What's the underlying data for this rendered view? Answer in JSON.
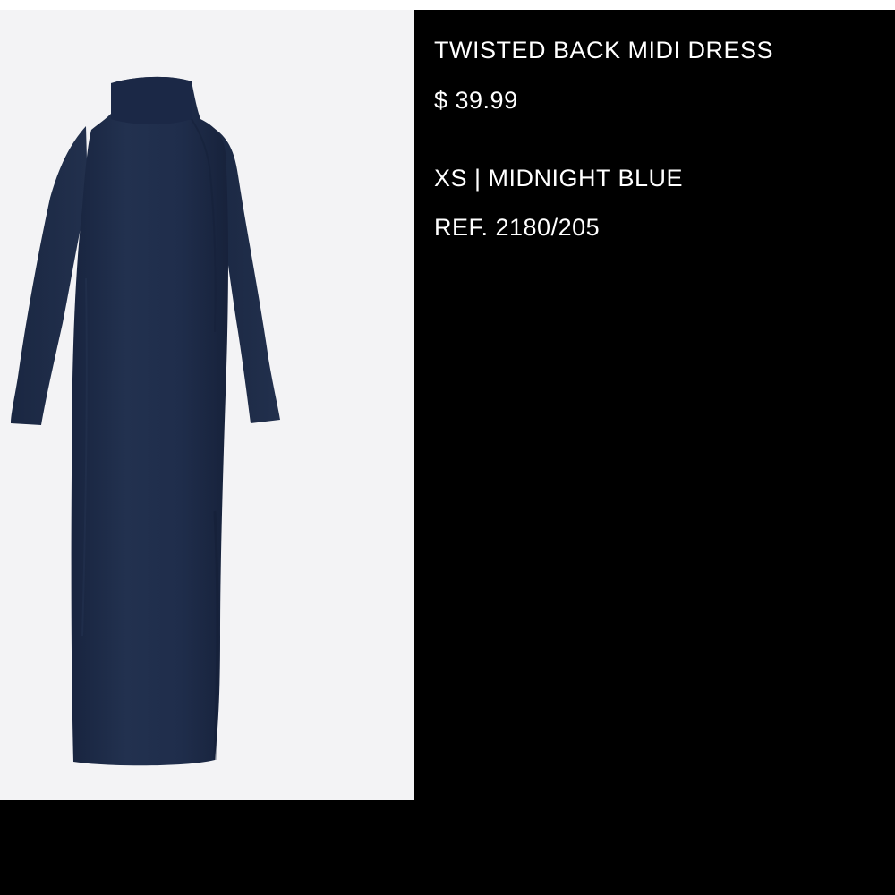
{
  "product": {
    "title": "TWISTED BACK MIDI DRESS",
    "price": "$ 39.99",
    "variant": "XS | MIDNIGHT BLUE",
    "reference": "REF. 2180/205"
  },
  "image": {
    "icon": "dress-photo",
    "background_color": "#f3f3f5",
    "garment_color": "#1e2c4c"
  },
  "theme": {
    "panel_color": "#000000",
    "text_color": "#ffffff"
  }
}
